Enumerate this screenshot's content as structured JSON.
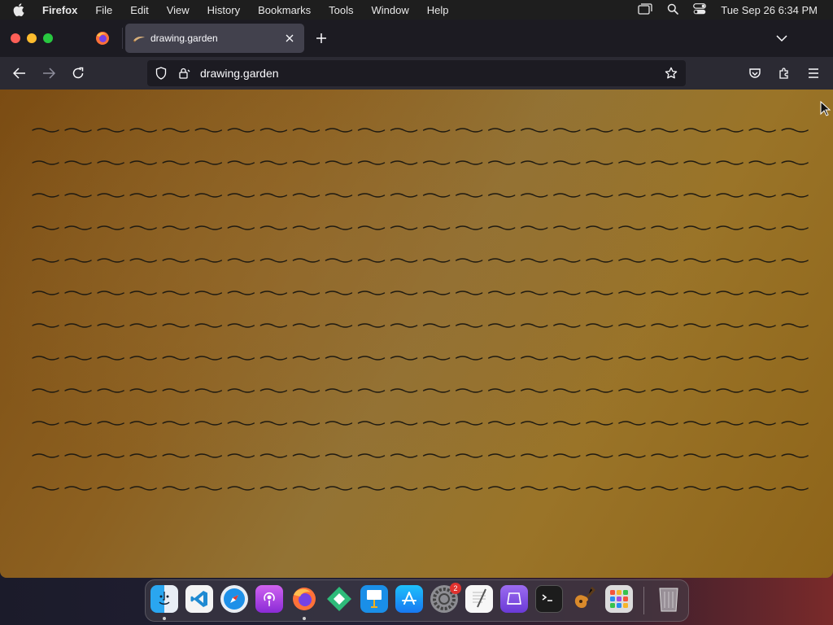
{
  "menubar": {
    "app_name": "Firefox",
    "items": [
      "File",
      "Edit",
      "View",
      "History",
      "Bookmarks",
      "Tools",
      "Window",
      "Help"
    ],
    "clock": "Tue Sep 26  6:34 PM"
  },
  "browser": {
    "active_tab_title": "drawing.garden",
    "url": "drawing.garden"
  },
  "page": {
    "wave_rows": 12,
    "waves_per_row": 24,
    "wave_color": "#1e1a12"
  },
  "dock": {
    "apps": [
      {
        "name": "Finder",
        "icon": "finder-icon",
        "running": true
      },
      {
        "name": "Visual Studio Code",
        "icon": "vscode-icon",
        "running": false
      },
      {
        "name": "Safari",
        "icon": "safari-icon",
        "running": false
      },
      {
        "name": "Podcasts",
        "icon": "podcasts-icon",
        "running": false
      },
      {
        "name": "Firefox",
        "icon": "firefox-icon",
        "running": true
      },
      {
        "name": "Tower",
        "icon": "diamond-app-icon",
        "running": false
      },
      {
        "name": "Keynote",
        "icon": "keynote-icon",
        "running": false
      },
      {
        "name": "App Store",
        "icon": "app-store-icon",
        "running": false
      },
      {
        "name": "System Settings",
        "icon": "settings-icon",
        "running": false,
        "badge": "2"
      },
      {
        "name": "TextEdit",
        "icon": "textedit-icon",
        "running": false
      },
      {
        "name": "Purple App",
        "icon": "purple-app-icon",
        "running": false
      },
      {
        "name": "Terminal",
        "icon": "terminal-icon",
        "running": false
      },
      {
        "name": "GarageBand",
        "icon": "guitar-icon",
        "running": false
      },
      {
        "name": "Launchpad",
        "icon": "launchpad-icon",
        "running": false
      },
      {
        "name": "Trash",
        "icon": "trash-icon",
        "running": false
      }
    ]
  },
  "colors": {
    "tab_active": "#42414d",
    "toolbar": "#2b2a33",
    "urlbar": "#1c1b22"
  }
}
